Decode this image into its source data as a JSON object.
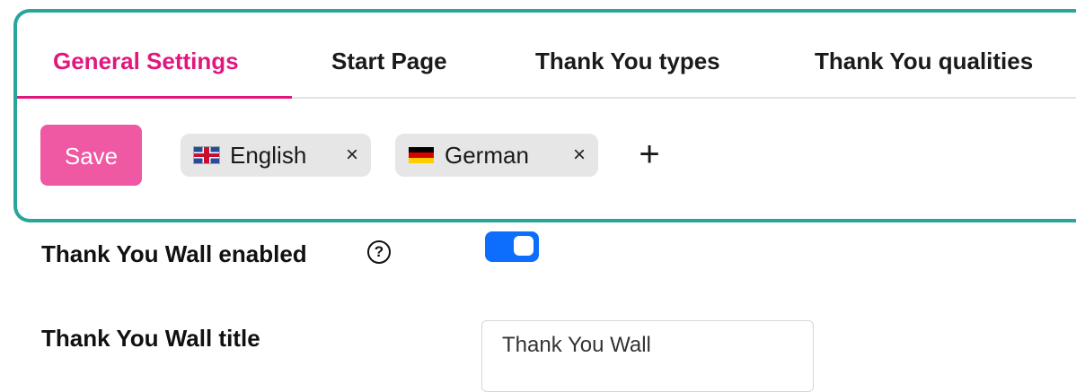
{
  "tabs": [
    {
      "label": "General Settings",
      "active": true
    },
    {
      "label": "Start Page"
    },
    {
      "label": "Thank You types"
    },
    {
      "label": "Thank You qualities"
    }
  ],
  "toolbar": {
    "save_label": "Save",
    "add_label": "+",
    "languages": [
      {
        "label": "English",
        "flag": "uk-flag",
        "remove": "×"
      },
      {
        "label": "German",
        "flag": "germany-flag",
        "remove": "×"
      }
    ]
  },
  "fields": {
    "wall_enabled": {
      "label": "Thank You Wall enabled",
      "help": "?",
      "enabled": true
    },
    "wall_title": {
      "label": "Thank You Wall title",
      "value": "Thank You Wall"
    }
  },
  "colors": {
    "accent": "#e0187e",
    "save_button": "#ef58a2",
    "toggle_on": "#0d6efd",
    "highlight_frame": "#2aa59a"
  }
}
